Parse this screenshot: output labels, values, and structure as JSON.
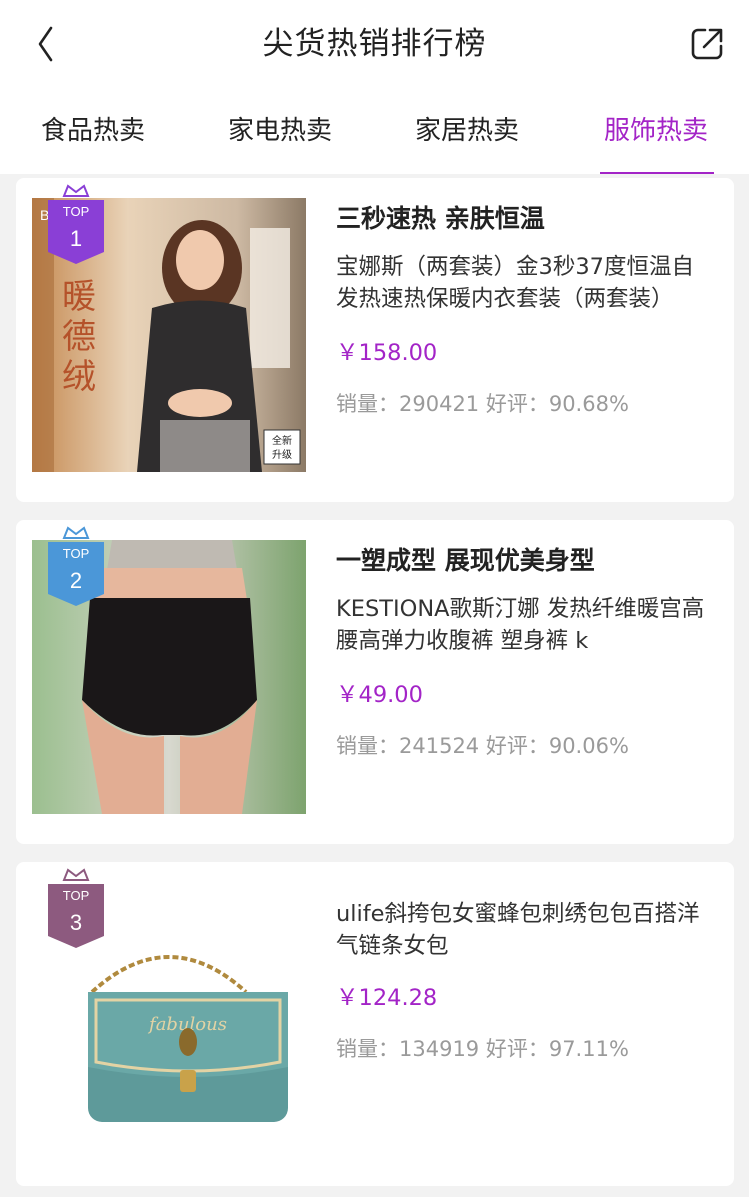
{
  "header": {
    "title": "尖货热销排行榜",
    "back_icon": "chevron-left-icon",
    "share_icon": "share-external-icon"
  },
  "tabs": [
    {
      "label": "食品热卖",
      "active": false
    },
    {
      "label": "家电热卖",
      "active": false
    },
    {
      "label": "家居热卖",
      "active": false
    },
    {
      "label": "服饰热卖",
      "active": true
    }
  ],
  "colors": {
    "accent": "#a324c7",
    "badge_1": "#8a3fd6",
    "badge_2": "#4b97d8",
    "badge_3": "#8d5a7f",
    "muted_text": "#9a9a9a",
    "background": "#f2f2f2"
  },
  "products": [
    {
      "badge_top": "TOP",
      "rank": "1",
      "headline": "三秒速热 亲肤恒温",
      "description": "宝娜斯（两套装）金3秒37度恒温自发热速热保暖内衣套装（两套装）",
      "price": "￥158.00",
      "stats": "销量：290421  好评：90.68%",
      "image_text": {
        "brand": "BONAS",
        "title": "暖德绒",
        "tag": "全新升级"
      }
    },
    {
      "badge_top": "TOP",
      "rank": "2",
      "headline": "一塑成型 展现优美身型",
      "description": "KESTIONA歌斯汀娜 发热纤维暖宫高腰高弹力收腹裤 塑身裤 k",
      "price": "￥49.00",
      "stats": "销量：241524  好评：90.06%"
    },
    {
      "badge_top": "TOP",
      "rank": "3",
      "headline": "",
      "description": "ulife斜挎包女蜜蜂包刺绣包包百搭洋气链条女包",
      "price": "￥124.28",
      "stats": "销量：134919  好评：97.11%",
      "image_text": {
        "bag_text": "fabulous"
      }
    }
  ]
}
